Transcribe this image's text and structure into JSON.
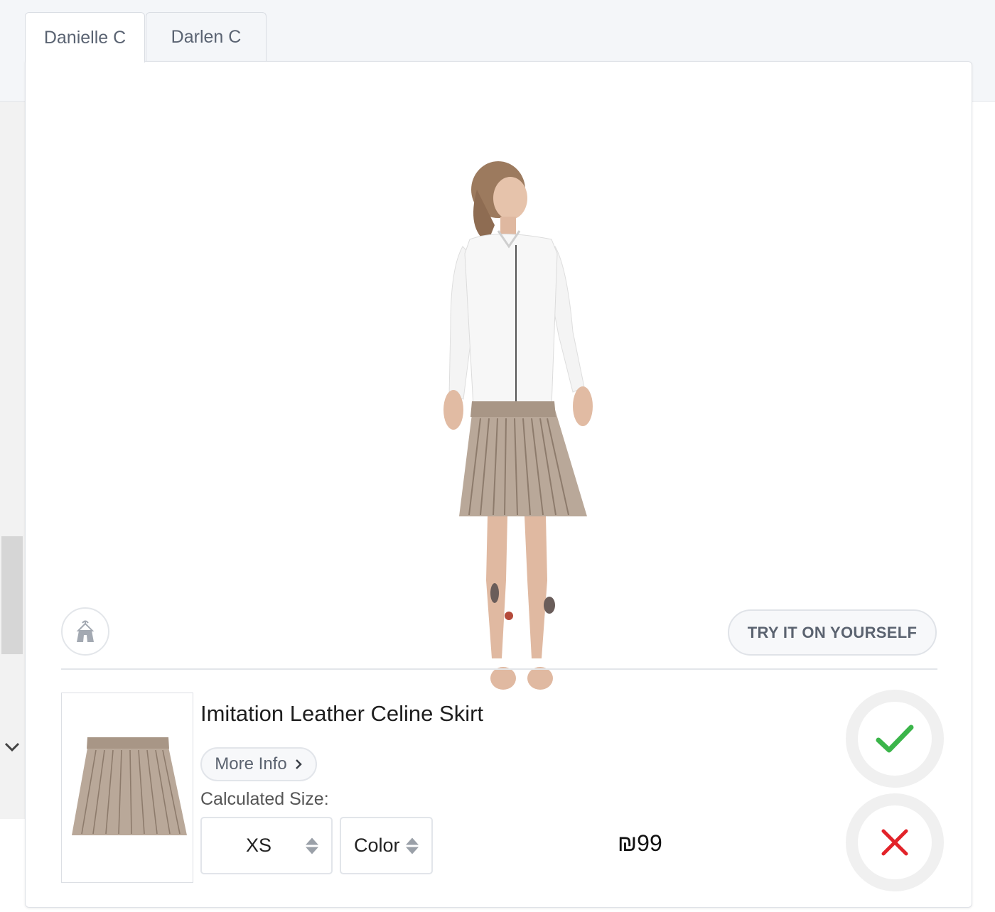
{
  "tabs": [
    {
      "label": "Danielle C",
      "active": true
    },
    {
      "label": "Darlen C",
      "active": false
    }
  ],
  "fitting": {
    "try_button_label": "TRY IT ON YOURSELF",
    "hanger_icon": "hanger-icon"
  },
  "product": {
    "title": "Imitation Leather Celine Skirt",
    "more_info_label": "More Info",
    "calculated_size_label": "Calculated Size:",
    "size_value": "XS",
    "color_value": "Color",
    "price": "₪99"
  },
  "actions": {
    "accept_icon": "checkmark-icon",
    "reject_icon": "close-icon"
  },
  "colors": {
    "accept": "#3bb54a",
    "reject": "#e2232a",
    "skirt": "#b9a899"
  }
}
